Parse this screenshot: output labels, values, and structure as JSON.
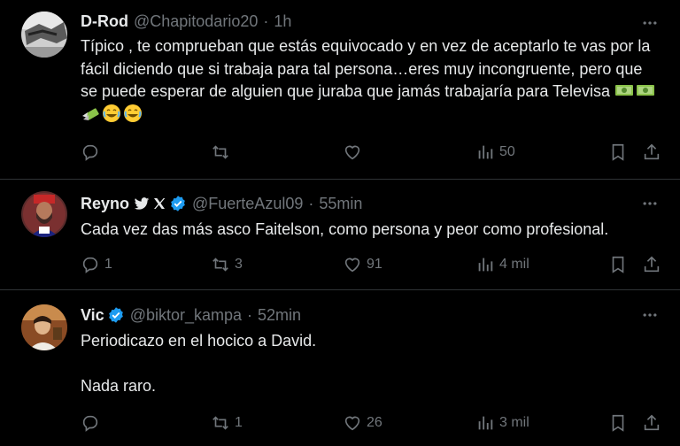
{
  "tweets": [
    {
      "display_name": "D-Rod",
      "handle": "@Chapitodario20",
      "dot": "·",
      "time": "1h",
      "text_lines": [
        "Típico , te comprueban que estás equivocado y en vez de aceptarlo te vas por la fácil diciendo que si trabaja para tal persona…eres muy incongruente, pero que se puede esperar de alguien que juraba que jamás trabajaría para Televisa"
      ],
      "emojis": [
        "money-bill-icon",
        "money-bill-icon",
        "money-with-wings-icon",
        "laughing-icon",
        "laughing-icon"
      ],
      "replies": "",
      "retweets": "",
      "likes": "",
      "views": "50"
    },
    {
      "display_name": "Reyno",
      "handle": "@FuerteAzul09",
      "dot": "·",
      "time": "55min",
      "text_lines": [
        "Cada vez das más asco Faitelson, como persona y peor como profesional."
      ],
      "replies": "1",
      "retweets": "3",
      "likes": "91",
      "views": "4 mil"
    },
    {
      "display_name": "Vic",
      "handle": "@biktor_kampa",
      "dot": "·",
      "time": "52min",
      "text_lines": [
        "Periodicazo en el hocico a David.",
        "Nada raro."
      ],
      "replies": "",
      "retweets": "1",
      "likes": "26",
      "views": "3 mil"
    }
  ],
  "colors": {
    "background": "#000000",
    "text": "#e7e9ea",
    "muted": "#71767b",
    "divider": "#2f3336",
    "verified": "#1d9bf0"
  }
}
